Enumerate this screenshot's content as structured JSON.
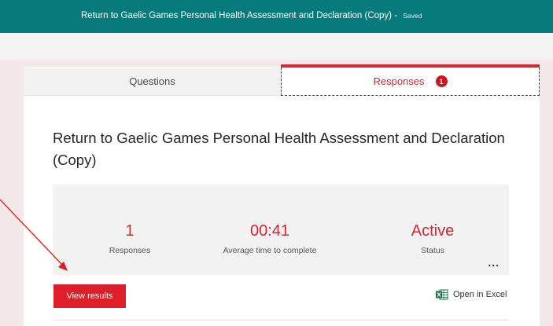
{
  "header": {
    "title": "Return to Gaelic Games Personal Health Assessment and Declaration (Copy)",
    "separator": " - ",
    "saved": "Saved"
  },
  "tabs": [
    {
      "label": "Questions",
      "active": false
    },
    {
      "label": "Responses",
      "active": true,
      "badge": "1"
    }
  ],
  "form": {
    "title": "Return to Gaelic Games Personal Health Assessment and Declaration (Copy)"
  },
  "stats": [
    {
      "value": "1",
      "label": "Responses"
    },
    {
      "value": "00:41",
      "label": "Average time to complete"
    },
    {
      "value": "Active",
      "label": "Status"
    }
  ],
  "more_menu": "...",
  "actions": {
    "view_results": "View results",
    "open_in_excel": "Open in Excel"
  },
  "colors": {
    "header": "#077a7b",
    "accent": "#d9262f",
    "excel": "#1e7145"
  },
  "icons": {
    "excel": "excel-icon",
    "more": "more-icon",
    "annotation": "annotation-arrow"
  }
}
